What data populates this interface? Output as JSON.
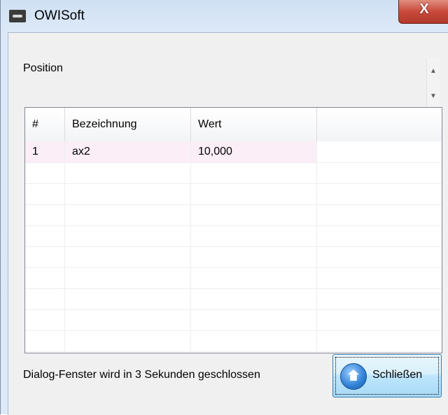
{
  "window": {
    "title": "OWISoft",
    "close_glyph": "X",
    "icon": "app-icon"
  },
  "position_section": {
    "label": "Position",
    "scroll_up_glyph": "▲",
    "scroll_down_glyph": "▼"
  },
  "table": {
    "columns": [
      "#",
      "Bezeichnung",
      "Wert",
      ""
    ],
    "rows": [
      {
        "num": "1",
        "name": "ax2",
        "value": "10,000"
      }
    ]
  },
  "status": {
    "text": "Dialog-Fenster wird in 3 Sekunden geschlossen"
  },
  "buttons": {
    "close_label": "Schließen",
    "close_icon": "home-icon"
  }
}
